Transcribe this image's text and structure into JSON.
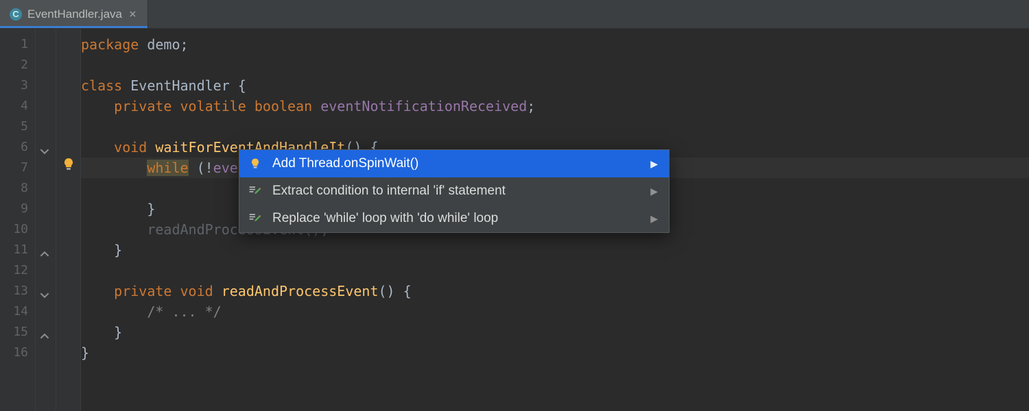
{
  "tab": {
    "filename": "EventHandler.java",
    "icon_letter": "C"
  },
  "gutter": {
    "lines": [
      "1",
      "2",
      "3",
      "4",
      "5",
      "6",
      "7",
      "8",
      "9",
      "10",
      "11",
      "12",
      "13",
      "14",
      "15",
      "16"
    ]
  },
  "code": {
    "l1": {
      "kw1": "package",
      "id": "demo",
      "t3": ";"
    },
    "l3": {
      "kw": "class",
      "name": "EventHandler",
      "brace": " {"
    },
    "l4": {
      "mods": "private volatile boolean",
      "field": "eventNotificationReceived",
      "semi": ";"
    },
    "l6": {
      "kw": "void",
      "mth": "waitForEventAndHandleIt",
      "parens": "()",
      "brace": " {"
    },
    "l7": {
      "wh": "while",
      "open": " (!",
      "field": "eventNotificationReceived",
      "close": ") {"
    },
    "l9": {
      "close": "}"
    },
    "l10": {
      "obscured": "readAndProcessEvent();"
    },
    "l11": {
      "close": "}"
    },
    "l13": {
      "mods": "private void",
      "mth": "readAndProcessEvent",
      "parens": "()",
      "brace": " {"
    },
    "l14": {
      "cmt": "/* ... */"
    },
    "l15": {
      "close": "}"
    },
    "l16": {
      "close": "}"
    }
  },
  "intentions": {
    "items": [
      {
        "label": "Add Thread.onSpinWait()",
        "icon": "bulb",
        "selected": true
      },
      {
        "label": "Extract condition to internal 'if' statement",
        "icon": "pencil",
        "selected": false
      },
      {
        "label": "Replace 'while' loop with 'do while' loop",
        "icon": "pencil",
        "selected": false
      }
    ]
  }
}
